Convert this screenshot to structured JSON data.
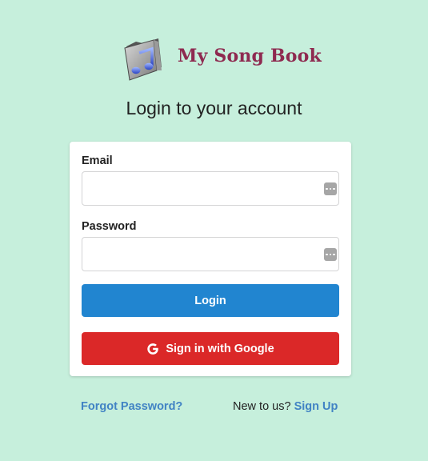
{
  "brand": {
    "name": "My Song Book",
    "logo_icon": "music-folder-icon"
  },
  "page": {
    "title": "Login to your account"
  },
  "form": {
    "email_label": "Email",
    "email_value": "",
    "password_label": "Password",
    "password_value": "",
    "autofill_icon": "password-manager-icon",
    "login_label": "Login",
    "google_label": "Sign in with Google",
    "google_icon": "google-icon"
  },
  "footer": {
    "forgot_password": "Forgot Password?",
    "new_user_text": "New to us?",
    "signup_link": "Sign Up"
  },
  "colors": {
    "background": "#c6efdc",
    "brand": "#8e2a50",
    "primary": "#2185d0",
    "google": "#db2828",
    "link": "#4183c4"
  }
}
